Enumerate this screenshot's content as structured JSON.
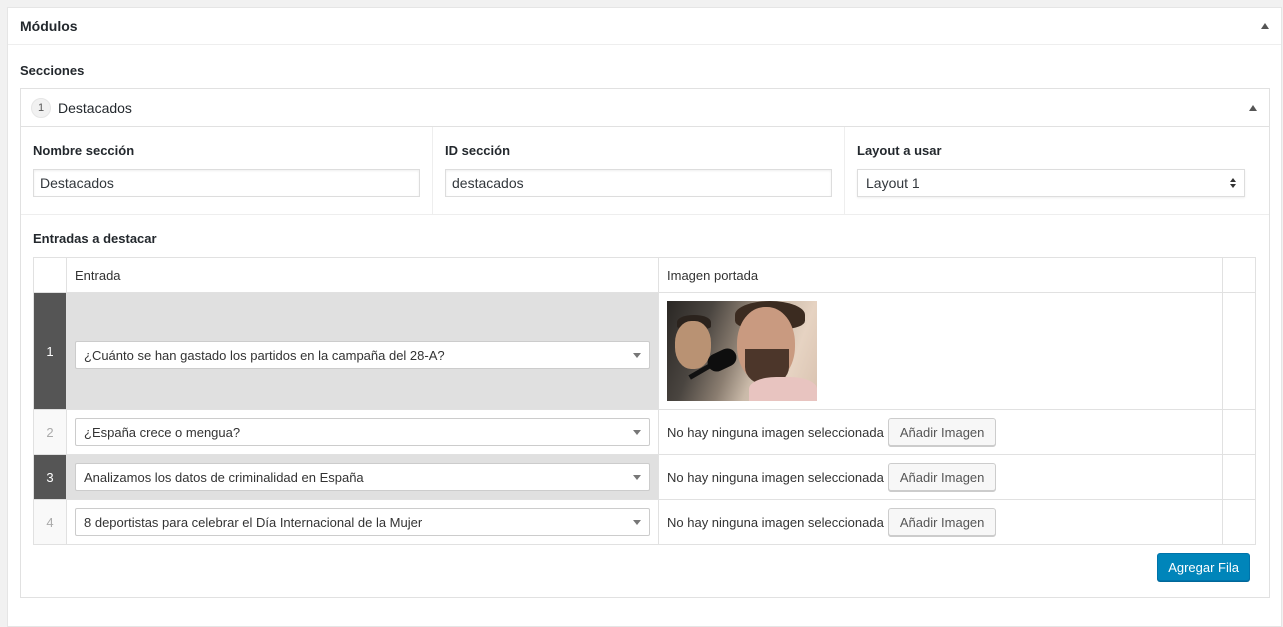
{
  "panel": {
    "title": "Módulos"
  },
  "secciones_label": "Secciones",
  "layout": {
    "order": "1",
    "title": "Destacados",
    "fields": [
      {
        "label": "Nombre sección",
        "value": "Destacados"
      },
      {
        "label": "ID sección",
        "value": "destacados"
      },
      {
        "label": "Layout a usar",
        "value": "Layout 1"
      }
    ],
    "entradas_label": "Entradas a destacar",
    "table": {
      "headers": [
        "Entrada",
        "Imagen portada"
      ],
      "rows": [
        {
          "order": "1",
          "entrada": "¿Cuánto se han gastado los partidos en la campaña del 28-A?",
          "image": "photo",
          "no_image_text": ""
        },
        {
          "order": "2",
          "entrada": "¿España crece o mengua?",
          "image": "",
          "no_image_text": "No hay ninguna imagen seleccionada"
        },
        {
          "order": "3",
          "entrada": "Analizamos los datos de criminalidad en España",
          "image": "",
          "no_image_text": "No hay ninguna imagen seleccionada"
        },
        {
          "order": "4",
          "entrada": "8 deportistas para celebrar el Día Internacional de la Mujer",
          "image": "",
          "no_image_text": "No hay ninguna imagen seleccionada"
        }
      ]
    },
    "add_image_label": "Añadir Imagen",
    "add_row_label": "Agregar Fila"
  },
  "colors": {
    "primary": "#0085ba",
    "active_order": "#555555",
    "active_row": "#e0e0e0"
  }
}
